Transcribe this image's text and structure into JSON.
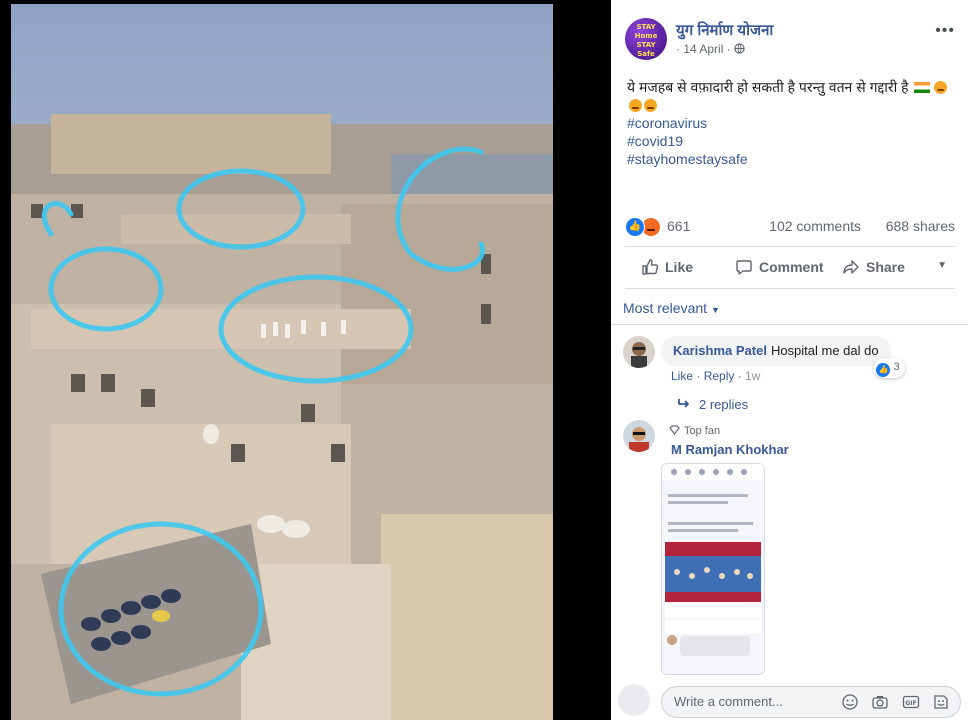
{
  "post": {
    "page_name": "युग निर्माण योजना",
    "date": "14 April",
    "avatar_text": [
      "STAY",
      "Home",
      "STAY",
      "Safe"
    ],
    "text_line": "ये मजहब से वफ़ादारी हो सकती है परन्तु वतन से गद्दारी है",
    "hashtags": [
      "#coronavirus",
      "#covid19",
      "#stayhomestaysafe"
    ]
  },
  "stats": {
    "reactions": "661",
    "comments": "102 comments",
    "shares": "688 shares"
  },
  "actions": {
    "like": "Like",
    "comment": "Comment",
    "share": "Share"
  },
  "comments_filter": "Most relevant",
  "comments": [
    {
      "author": "Karishma Patel",
      "text": "Hospital me dal do",
      "like_label": "Like",
      "reply_label": "Reply",
      "time": "1w",
      "reaction_count": "3",
      "replies_label": "2 replies"
    },
    {
      "badge": "Top fan",
      "author": "M Ramjan Khokhar"
    }
  ],
  "composer": {
    "placeholder": "Write a comment..."
  },
  "colors": {
    "link": "#385898",
    "like_blue": "#1877f2",
    "angry_orange": "#f26b22",
    "highlight_circle": "#3ec8f0"
  }
}
